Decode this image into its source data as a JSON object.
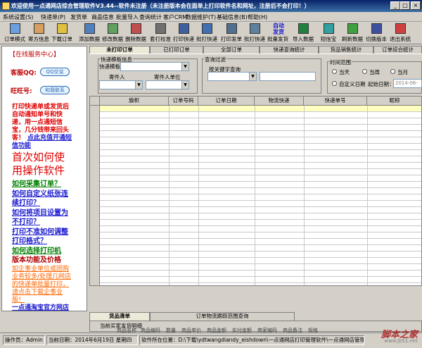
{
  "window": {
    "title": "欢迎使用一点通网店综合管理软件V3.44--软件未注册（未注册版本会在面单上打印软件名和网址，注册后不会打印！）",
    "min": "_",
    "max": "□",
    "close": "×"
  },
  "menu": [
    "系统设置(S)",
    "快递单(P)",
    "发货单",
    "商品信息",
    "批量导入",
    "查询统计",
    "客户CRM",
    "数据维护(T)",
    "基础信息(B)",
    "帮助(H)"
  ],
  "toolbar": [
    "订单模式",
    "寄方信息",
    "下载订单",
    "添加数据",
    "修改数据",
    "删除数据",
    "套打校准",
    "打印快递",
    "批打快递",
    "打印发单",
    "批打快递",
    "批量发货",
    "导入数据",
    "短信宝",
    "刷新数据",
    "切换版本",
    "退出系统"
  ],
  "toolbar_highlight": "自动\n发货",
  "left_panel": {
    "heading": "【在线服务中心】",
    "qq_label": "客服QQ:",
    "qq_badge": "QQ交谈",
    "ww_label": "旺旺号:",
    "ww_badge": "和我联系",
    "lines": [
      {
        "t": "打印快递单或发货后",
        "c": "red"
      },
      {
        "t": "自动通知单号和快",
        "c": "red"
      },
      {
        "t": "递，用一点通短信",
        "c": "red"
      },
      {
        "t": "宝，几分钱带来回头",
        "c": "red"
      },
      {
        "t": "客！",
        "c": "red"
      },
      {
        "t": "点此充值开通短",
        "c": "blue"
      },
      {
        "t": "信功能",
        "c": "blue"
      },
      {
        "t": "首次如何使",
        "c": "red",
        "big": true
      },
      {
        "t": "用操作软件",
        "c": "red",
        "big": true
      },
      {
        "t": "如何采集订单？",
        "c": "green"
      },
      {
        "t": "如何自定义纸张连",
        "c": "blue"
      },
      {
        "t": "续打印？",
        "c": "blue"
      },
      {
        "t": "如何将项目设置为",
        "c": "blue"
      },
      {
        "t": "不打印？",
        "c": "blue"
      },
      {
        "t": "打印不准如何调整",
        "c": "blue"
      },
      {
        "t": "打印格式？",
        "c": "blue"
      },
      {
        "t": "如何选择打印机",
        "c": "green"
      },
      {
        "t": "版本功能及价格",
        "c": "darkred"
      },
      {
        "t": "如企事业单位或团购",
        "c": "orange"
      },
      {
        "t": "业务较多/处理几网店",
        "c": "orange"
      },
      {
        "t": "的快递单批量打印，",
        "c": "orange"
      },
      {
        "t": "请点击下载企事业",
        "c": "orange"
      },
      {
        "t": "版！",
        "c": "orange"
      },
      {
        "t": "一点通淘宝官方网店",
        "c": "blue"
      }
    ]
  },
  "tabs": [
    "未打印订单",
    "已打印订单",
    "全部订单",
    "快递查询统计",
    "货品销售统计",
    "订单综合统计"
  ],
  "filter": {
    "group1": "快递模板信息",
    "template_label": "快递模板",
    "sender_label": "寄件人",
    "sender_unit_label": "寄件人单位",
    "group2": "查询过滤",
    "query_label": "按关键字查询",
    "group3": "时间范围",
    "r1": "当天",
    "r2": "当周",
    "r3": "当月",
    "r4": "自定义日期",
    "start_label": "起始日期：",
    "start_value": "2014-06-"
  },
  "grid": {
    "columns": [
      "旗帜",
      "订单号码",
      "订单日期",
      "物流快递",
      "快递单号",
      "昵称"
    ]
  },
  "bottom": {
    "tabs": [
      "货品清单",
      "订单物流跟踪范围查询"
    ],
    "section": "当前买家发货明细",
    "cols": [
      "商品名称",
      "商品编码",
      "数量",
      "商品单价",
      "商品金额",
      "实付金额",
      "商家编码",
      "商品备注",
      "规格"
    ]
  },
  "status": {
    "operator": "操作员：Admin",
    "date": "当前日期：2014年6月19日 星期四",
    "path": "软件所在位置：D:\\下载\\ydtwangdiandy_eishdown\\一点通网店打印管理软件\\一点通网店管理软件.exe"
  },
  "watermark": "脚本之家",
  "watermark_sub": "www.jb51.net"
}
